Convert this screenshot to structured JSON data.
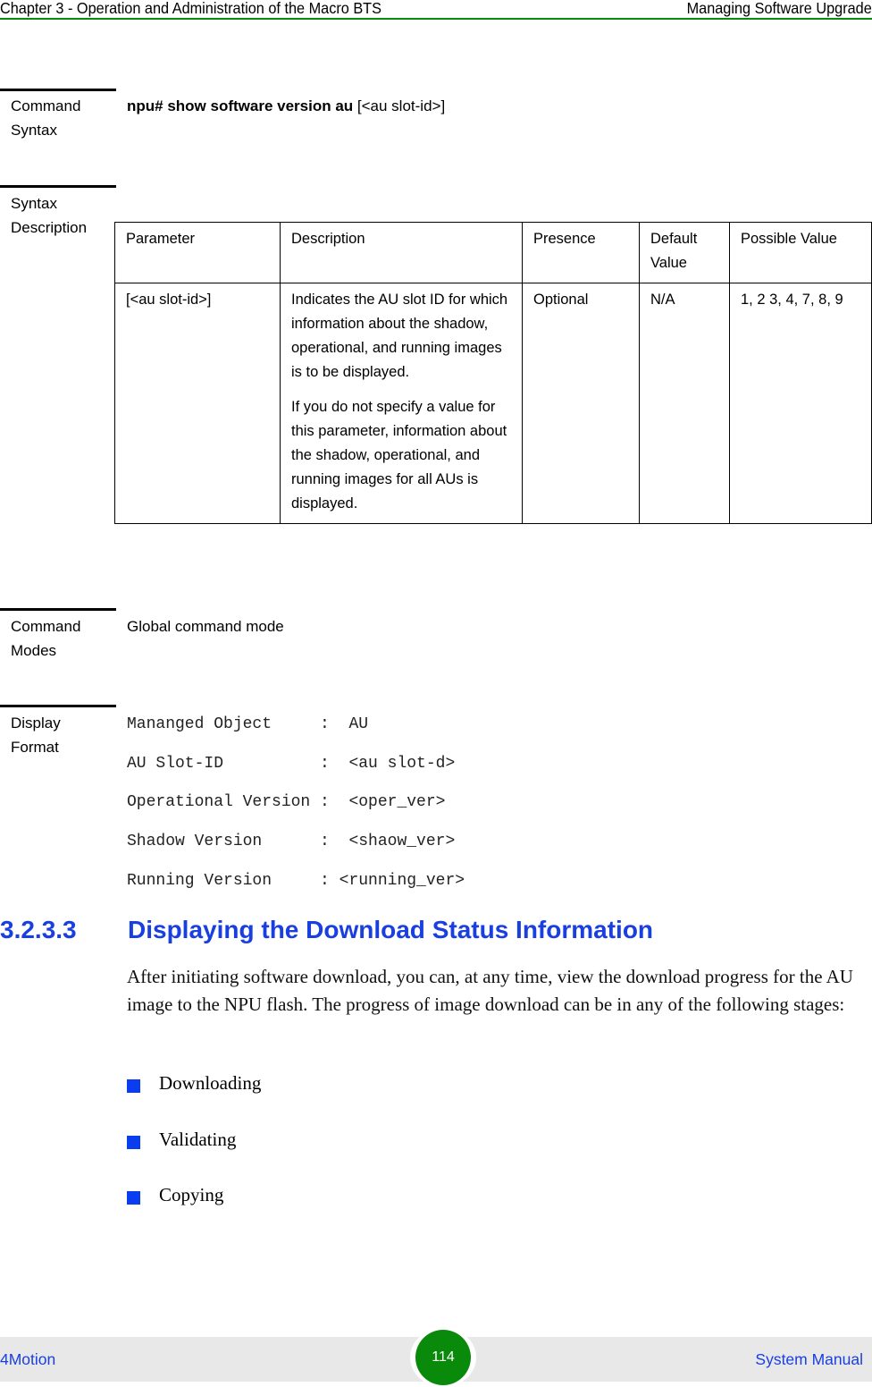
{
  "header": {
    "chapter": "Chapter 3 - Operation and Administration of the Macro BTS",
    "section": "Managing Software Upgrade",
    "rule_color": "#0a8a0a"
  },
  "command_syntax": {
    "label_line1": "Command",
    "label_line2": "Syntax",
    "command_bold": "npu# show software version au",
    "command_arg": " [<au slot-id>]"
  },
  "syntax_description": {
    "label_line1": "Syntax",
    "label_line2": "Description",
    "columns": [
      "Parameter",
      "Description",
      "Presence",
      "Default Value",
      "Possible Value"
    ],
    "rows": [
      {
        "parameter": "[<au slot-id>]",
        "description": [
          "Indicates the AU slot ID for which information about the shadow, operational, and running images is to be displayed.",
          "If you do not specify a value for this parameter, information about the shadow, operational, and running images for all AUs is displayed."
        ],
        "presence": "Optional",
        "default_value": "N/A",
        "possible_value": "1, 2 3, 4, 7, 8, 9"
      }
    ]
  },
  "command_modes": {
    "label_line1": "Command",
    "label_line2": "Modes",
    "value": "Global command mode"
  },
  "display_format": {
    "label_line1": "Display",
    "label_line2": "Format",
    "lines": [
      "Mananged Object     :  AU",
      "AU Slot-ID          :  <au slot-d>",
      "Operational Version :  <oper_ver>",
      "Shadow Version      :  <shaow_ver>",
      "Running Version     : <running_ver>"
    ]
  },
  "section": {
    "number": "3.2.3.3",
    "title": "Displaying the Download Status Information",
    "color": "#1a3fe0",
    "paragraph": "After initiating software download, you can, at any time, view the download progress for the AU image to the NPU flash. The progress of image download can be in any of the following stages:",
    "stages": [
      "Downloading",
      "Validating",
      "Copying"
    ]
  },
  "footer": {
    "left": "4Motion",
    "page_number": "114",
    "right": "System Manual",
    "badge_color": "#0a8a0a"
  }
}
